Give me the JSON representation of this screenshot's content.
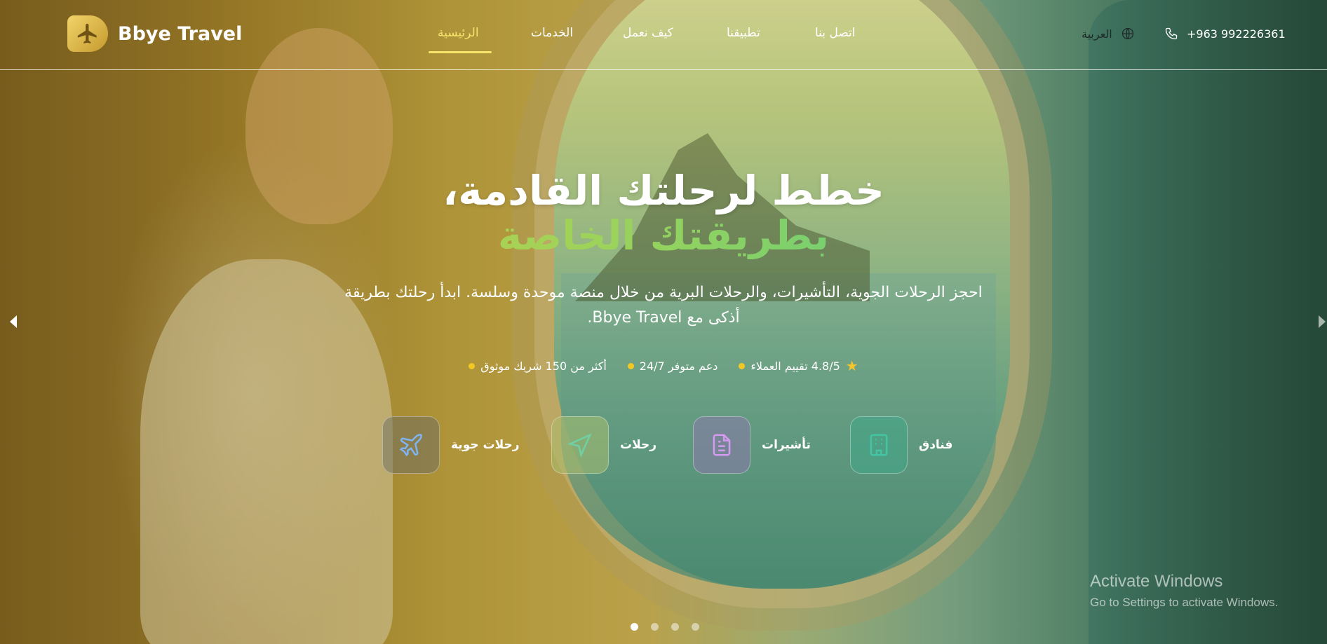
{
  "brand": {
    "name": "Bbye Travel"
  },
  "nav": {
    "items": [
      {
        "label": "الرئيسية",
        "active": true
      },
      {
        "label": "الخدمات",
        "active": false
      },
      {
        "label": "كيف نعمل",
        "active": false
      },
      {
        "label": "تطبيقنا",
        "active": false
      },
      {
        "label": "اتصل بنا",
        "active": false
      }
    ],
    "active_color": "#f5e36a"
  },
  "header_right": {
    "language": "العربية",
    "language_icon": "globe-icon",
    "phone": "+963 992226361",
    "phone_icon": "phone-icon"
  },
  "hero": {
    "title_line1": "خطط لرحلتك القادمة،",
    "title_line2": "بطريقتك الخاصة",
    "subtitle": "احجز الرحلات الجوية، التأشيرات، والرحلات البرية من خلال منصة موحدة وسلسة. ابدأ رحلتك بطريقة أذكى مع Bbye Travel.",
    "stats": [
      {
        "text": "4.8/5 تقييم العملاء",
        "icon": "star-icon"
      },
      {
        "text": "دعم متوفر 24/7"
      },
      {
        "text": "أكثر من 150 شريك موثوق"
      }
    ]
  },
  "services": [
    {
      "label": "فنادق",
      "icon": "hotel-icon",
      "color": "#44c4a2"
    },
    {
      "label": "تأشيرات",
      "icon": "document-icon",
      "color": "#d39af0"
    },
    {
      "label": "رحلات",
      "icon": "navigation-icon",
      "color": "#6ed0a4"
    },
    {
      "label": "رحلات جوية",
      "icon": "airplane-icon",
      "color": "#7fb4f2"
    }
  ],
  "carousel": {
    "slide_count": 4,
    "active_index": 0
  },
  "watermark": {
    "line1": "Activate Windows",
    "line2": "Go to Settings to activate Windows."
  }
}
